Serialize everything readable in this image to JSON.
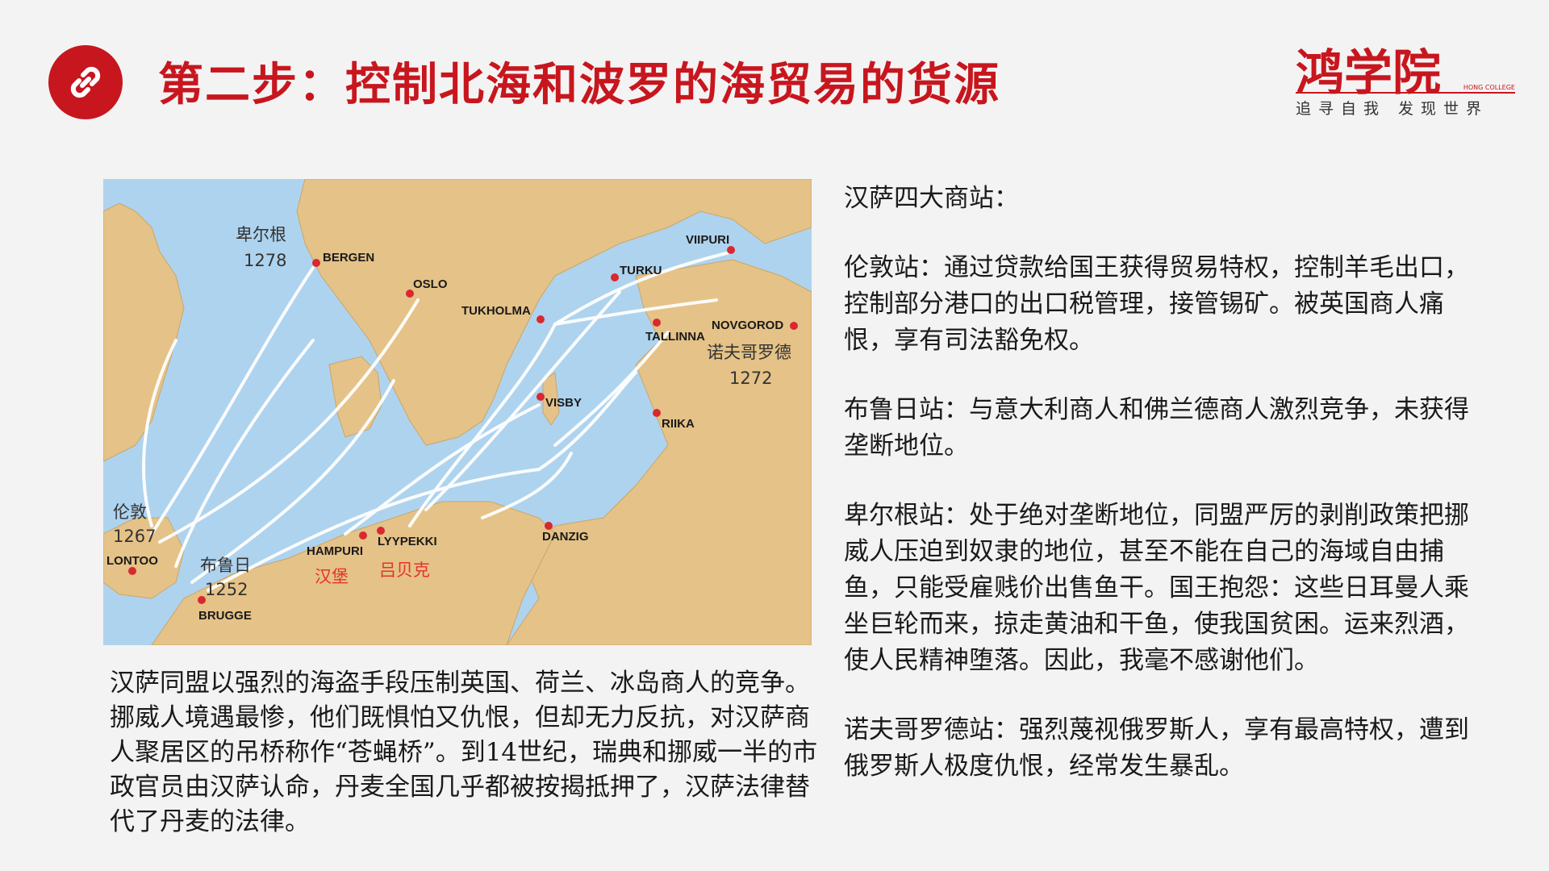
{
  "header": {
    "title": "第二步：控制北海和波罗的海贸易的货源",
    "icon": "link-icon",
    "accent_color": "#c8161e"
  },
  "logo": {
    "name": "鸿学院",
    "english": "HONG COLLEGE",
    "slogan": "追寻自我  发现世界"
  },
  "map": {
    "cities": {
      "bergen": "BERGEN",
      "oslo": "OSLO",
      "tukholma": "TUKHOLMA",
      "turku": "TURKU",
      "viipuri": "VIIPURI",
      "tallinna": "TALLINNA",
      "novgorod": "NOVGOROD",
      "visby": "VISBY",
      "riika": "RIIKA",
      "danzig": "DANZIG",
      "hampuri": "HAMPURI",
      "lyypekki": "LYYPEKKI",
      "lontoo": "LONTOO",
      "brugge": "BRUGGE"
    },
    "annotations": {
      "bergen_cn": "卑尔根",
      "bergen_year": "1278",
      "novgorod_cn": "诺夫哥罗德",
      "novgorod_year": "1272",
      "london_cn": "伦敦",
      "london_year": "1267",
      "bruges_cn": "布鲁日",
      "bruges_year": "1252",
      "hamburg_cn": "汉堡",
      "lubeck_cn": "吕贝克"
    }
  },
  "caption": "汉萨同盟以强烈的海盗手段压制英国、荷兰、冰岛商人的竞争。挪威人境遇最惨，他们既惧怕又仇恨，但却无力反抗，对汉萨商人聚居区的吊桥称作“苍蝇桥”。到14世纪，瑞典和挪威一半的市政官员由汉萨认命，丹麦全国几乎都被按揭抵押了，汉萨法律替代了丹麦的法律。",
  "stations": {
    "heading": "汉萨四大商站：",
    "london": "伦敦站：通过贷款给国王获得贸易特权，控制羊毛出口，控制部分港口的出口税管理，接管锡矿。被英国商人痛恨，享有司法豁免权。",
    "bruges": "布鲁日站：与意大利商人和佛兰德商人激烈竞争，未获得垄断地位。",
    "bergen": "卑尔根站：处于绝对垄断地位，同盟严厉的剥削政策把挪威人压迫到奴隶的地位，甚至不能在自己的海域自由捕鱼，只能受雇贱价出售鱼干。国王抱怨：这些日耳曼人乘坐巨轮而来，掠走黄油和干鱼，使我国贫困。运来烈酒，使人民精神堕落。因此，我毫不感谢他们。",
    "novgorod": "诺夫哥罗德站：强烈蔑视俄罗斯人，享有最高特权，遭到俄罗斯人极度仇恨，经常发生暴乱。"
  }
}
